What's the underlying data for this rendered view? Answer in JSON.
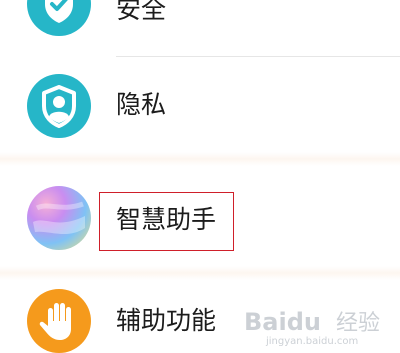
{
  "settings": {
    "items": [
      {
        "id": "security",
        "label": "安全",
        "icon": "shield-check-icon",
        "icon_color": "#26b6c8"
      },
      {
        "id": "privacy",
        "label": "隐私",
        "icon": "privacy-shield-person-icon",
        "icon_color": "#26b6c8"
      },
      {
        "id": "assistant",
        "label": "智慧助手",
        "icon": "gradient-orb-icon",
        "icon_color": "#c98df0"
      },
      {
        "id": "accessibility",
        "label": "辅助功能",
        "icon": "hand-icon",
        "icon_color": "#f59a1c"
      }
    ]
  },
  "annotation": {
    "highlight_color": "#cf1f2a"
  },
  "watermark": {
    "brand": "Baidu",
    "brand_suffix": "经验",
    "url": "jingyan.baidu.com"
  }
}
